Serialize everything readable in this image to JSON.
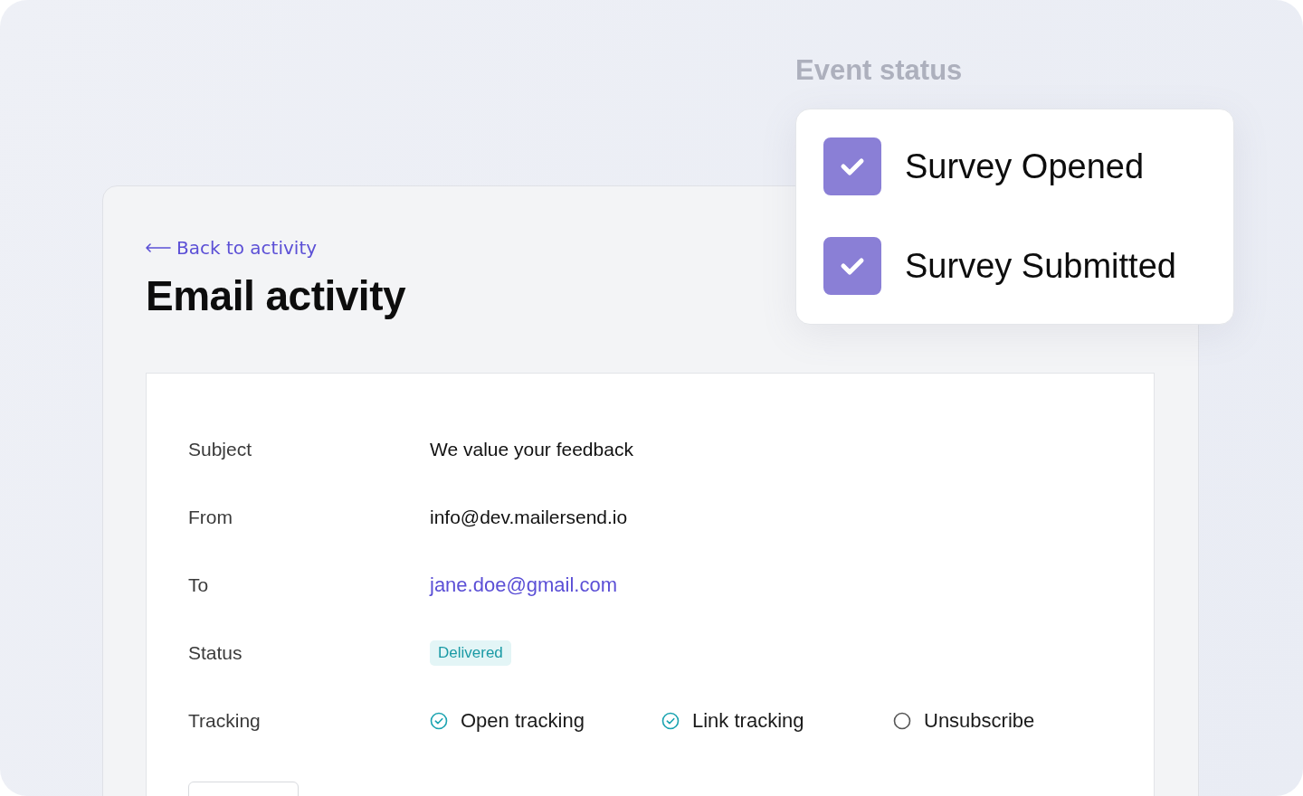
{
  "back_link": "Back to activity",
  "title": "Email activity",
  "details": [
    {
      "label": "Subject",
      "kind": "text",
      "value": "We value your feedback"
    },
    {
      "label": "From",
      "kind": "text",
      "value": "info@dev.mailersend.io"
    },
    {
      "label": "To",
      "kind": "link",
      "value": "jane.doe@gmail.com"
    },
    {
      "label": "Status",
      "kind": "badge",
      "value": "Delivered"
    },
    {
      "label": "Tracking",
      "kind": "tracking",
      "items": [
        {
          "label": "Open tracking",
          "checked": true
        },
        {
          "label": "Link tracking",
          "checked": true
        },
        {
          "label": "Unsubscribe",
          "checked": false
        }
      ]
    }
  ],
  "event_status": {
    "title": "Event status",
    "items": [
      {
        "label": "Survey Opened",
        "checked": true
      },
      {
        "label": "Survey Submitted",
        "checked": true
      }
    ]
  }
}
